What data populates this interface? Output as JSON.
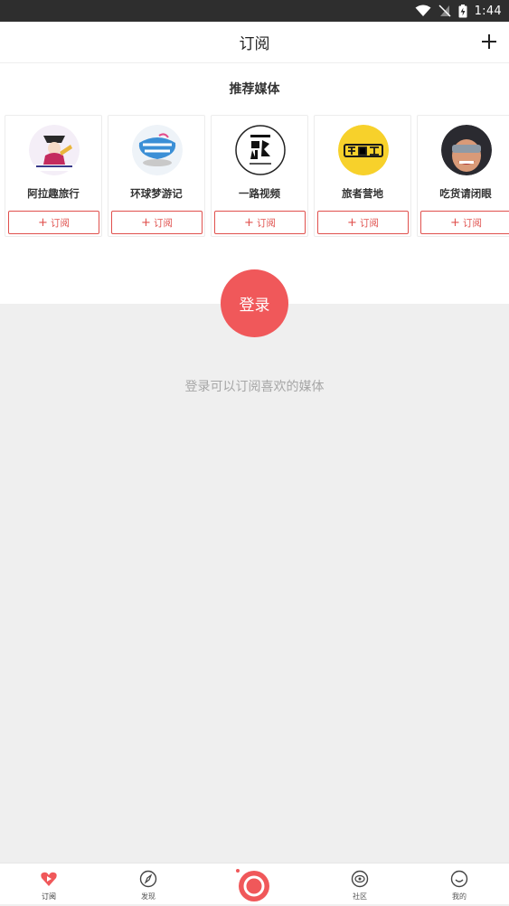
{
  "status_bar": {
    "time": "1:44"
  },
  "app_bar": {
    "title": "订阅"
  },
  "recommend": {
    "title": "推荐媒体",
    "subscribe_label": "订阅",
    "media": [
      {
        "name": "阿拉趣旅行"
      },
      {
        "name": "环球梦游记"
      },
      {
        "name": "一路视频"
      },
      {
        "name": "旅者营地"
      },
      {
        "name": "吃货请闭眼"
      }
    ]
  },
  "login": {
    "button_label": "登录",
    "hint": "登录可以订阅喜欢的媒体"
  },
  "tabs": [
    {
      "label": "订阅"
    },
    {
      "label": "发现"
    },
    {
      "label": "社区"
    },
    {
      "label": "我的"
    }
  ],
  "colors": {
    "accent": "#f0585a",
    "subscribe_border": "#e0504d"
  }
}
